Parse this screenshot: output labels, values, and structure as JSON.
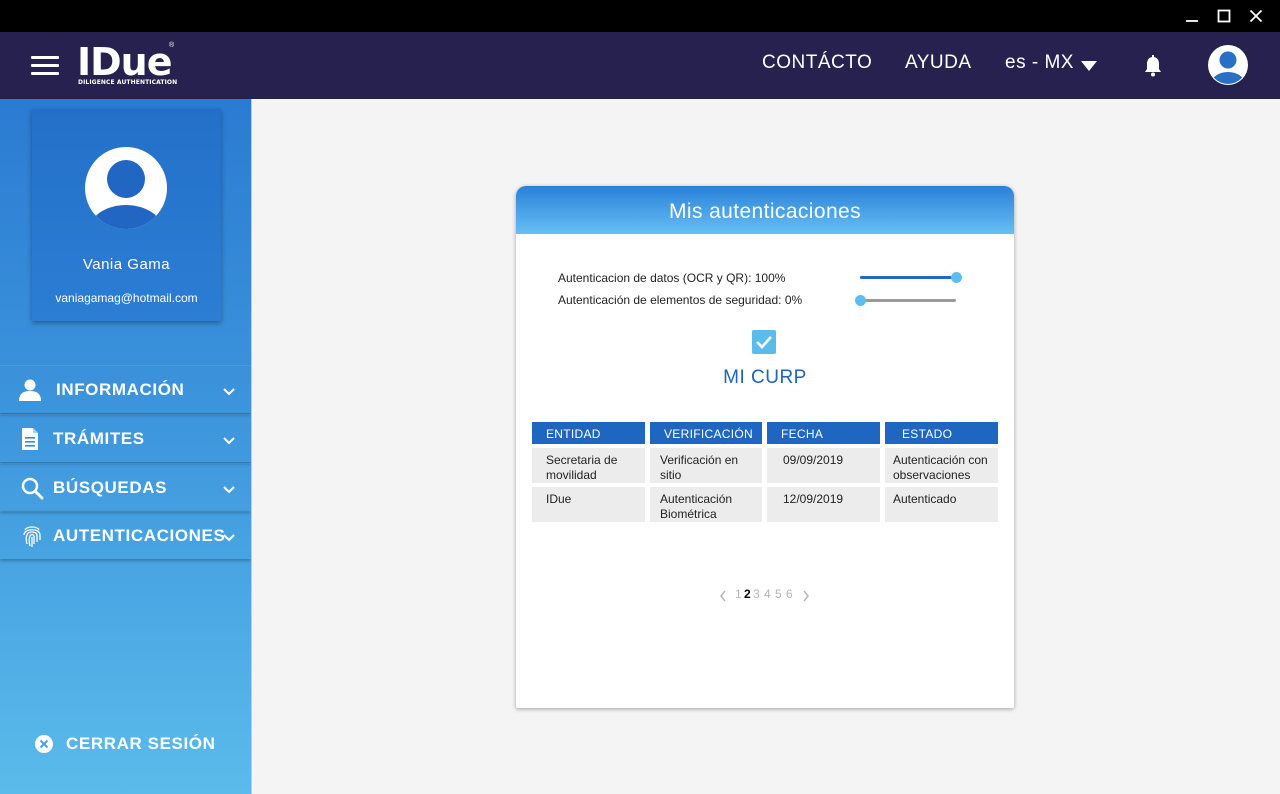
{
  "header": {
    "logo_text": "IDue",
    "logo_subtext": "DILIGENCE AUTHENTICATION",
    "logo_registered": "®",
    "nav": {
      "contact": "CONTÁCTO",
      "help": "AYUDA"
    },
    "language": "es - MX"
  },
  "profile": {
    "name": "Vania Gama",
    "email": "vaniagamag@hotmail.com"
  },
  "sidebar": {
    "items": [
      {
        "label": "INFORMACIÓN",
        "icon": "person-icon"
      },
      {
        "label": "TRÁMITES",
        "icon": "document-icon"
      },
      {
        "label": "BÚSQUEDAS",
        "icon": "search-icon"
      },
      {
        "label": "AUTENTICACIONES",
        "icon": "fingerprint-icon"
      }
    ],
    "logout": "CERRAR SESIÓN"
  },
  "card": {
    "title": "Mis autenticaciones",
    "progress": [
      {
        "label": "Autenticacion de datos (OCR y QR): 100%",
        "value": 1.0
      },
      {
        "label": "Autenticación de elementos de seguridad: 0%",
        "value": 0.0
      }
    ],
    "curp_label": "MI CURP",
    "curp_checked": true,
    "table": {
      "headers": [
        "ENTIDAD",
        "VERIFICACIÓN",
        "FECHA",
        "ESTADO"
      ],
      "rows": [
        [
          "Secretaria de movilidad",
          "Verificación en sitio",
          "09/09/2019",
          "Autenticación con observaciones"
        ],
        [
          "IDue",
          "Autenticación Biométrica",
          "12/09/2019",
          "Autenticado"
        ]
      ]
    },
    "pagination": {
      "pages": [
        "1",
        "2",
        "3",
        "4",
        "5",
        "6"
      ],
      "current": "2"
    }
  },
  "colors": {
    "header_bg": "#27214f",
    "accent_blue": "#1f66c0",
    "light_blue": "#5bbbeb",
    "titlebar_bg": "#000000"
  }
}
